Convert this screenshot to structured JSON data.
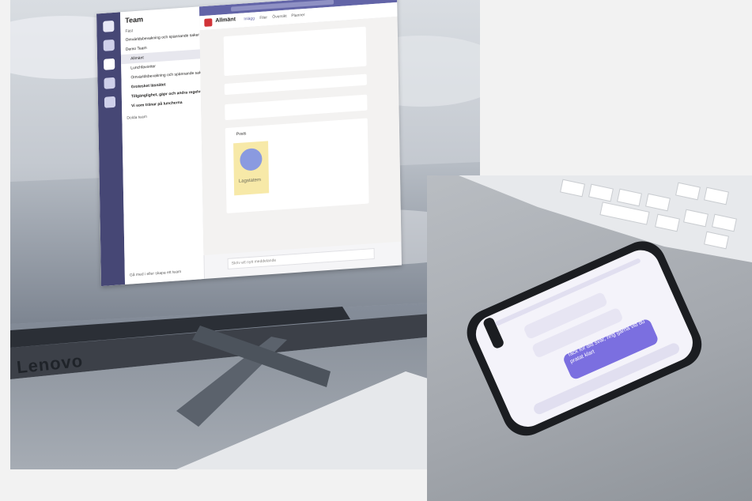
{
  "monitor": {
    "brand": "Lenovo",
    "teams": {
      "rail_items": [
        "Activity",
        "Chat",
        "Teams",
        "Calls",
        "Files"
      ],
      "sidebar_title": "Team",
      "favorites_label": "Fäst",
      "channels": [
        "Omvärldsbevakning och spännande saker s...",
        "Demo Team",
        "Allmänt",
        "Lunchfavoriter",
        "Omvärldsbevakning och spännande saker s...",
        "Grotesket läsnätet",
        "Tillgänglighet, gäpr och andra regelverk",
        "Vi som tränar på luncherna"
      ],
      "other_teams_label": "Dolda team",
      "join_team": "Gå med i eller skapa ett team",
      "channel_title": "Allmänt",
      "channel_tabs": [
        "Inlägg",
        "Filer",
        "Översikt",
        "Planner"
      ],
      "card_app": "Posts",
      "card_image_label": "Lagstatem",
      "compose_hint": "Skriv ett nytt meddelande"
    }
  },
  "phone": {
    "chat_bubble": "Tack för ditt svar, ring gärna vid du pratat klart",
    "colors": {
      "bubble": "#7b6fe0",
      "screen": "#f4f3fa"
    }
  },
  "colors": {
    "teams_rail": "#464775",
    "teams_accent": "#6264a7"
  }
}
